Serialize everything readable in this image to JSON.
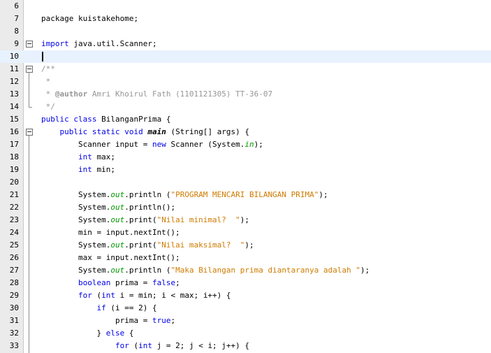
{
  "editor": {
    "lines": [
      {
        "n": "6",
        "tokens": []
      },
      {
        "n": "7",
        "tokens": [
          {
            "t": "package kuistakehome;",
            "c": ""
          }
        ]
      },
      {
        "n": "8",
        "tokens": []
      },
      {
        "n": "9",
        "tokens": [
          {
            "t": "import",
            "c": "kw"
          },
          {
            "t": " java.util.Scanner;",
            "c": ""
          }
        ],
        "fold": "start"
      },
      {
        "n": "10",
        "tokens": [],
        "current": true
      },
      {
        "n": "11",
        "tokens": [
          {
            "t": "/**",
            "c": "cmt"
          }
        ],
        "fold": "start"
      },
      {
        "n": "12",
        "tokens": [
          {
            "t": " *",
            "c": "cmt"
          }
        ],
        "fold": "mid"
      },
      {
        "n": "13",
        "tokens": [
          {
            "t": " * ",
            "c": "cmt"
          },
          {
            "t": "@author",
            "c": "tag"
          },
          {
            "t": " Amri Khoirul Fath (1101121305) TT-36-07",
            "c": "cmt"
          }
        ],
        "fold": "mid"
      },
      {
        "n": "14",
        "tokens": [
          {
            "t": " */",
            "c": "cmt"
          }
        ],
        "fold": "end"
      },
      {
        "n": "15",
        "tokens": [
          {
            "t": "public class",
            "c": "kw"
          },
          {
            "t": " BilanganPrima {",
            "c": ""
          }
        ]
      },
      {
        "n": "16",
        "tokens": [
          {
            "t": "    ",
            "c": ""
          },
          {
            "t": "public static void",
            "c": "kw"
          },
          {
            "t": " ",
            "c": ""
          },
          {
            "t": "main",
            "c": "method-decl"
          },
          {
            "t": " (String[] args) {",
            "c": ""
          }
        ],
        "fold": "start"
      },
      {
        "n": "17",
        "tokens": [
          {
            "t": "        Scanner input = ",
            "c": ""
          },
          {
            "t": "new",
            "c": "kw"
          },
          {
            "t": " Scanner (System.",
            "c": ""
          },
          {
            "t": "in",
            "c": "field"
          },
          {
            "t": ");",
            "c": ""
          }
        ]
      },
      {
        "n": "18",
        "tokens": [
          {
            "t": "        ",
            "c": ""
          },
          {
            "t": "int",
            "c": "kw"
          },
          {
            "t": " max;",
            "c": ""
          }
        ]
      },
      {
        "n": "19",
        "tokens": [
          {
            "t": "        ",
            "c": ""
          },
          {
            "t": "int",
            "c": "kw"
          },
          {
            "t": " min;",
            "c": ""
          }
        ]
      },
      {
        "n": "20",
        "tokens": []
      },
      {
        "n": "21",
        "tokens": [
          {
            "t": "        System.",
            "c": ""
          },
          {
            "t": "out",
            "c": "field"
          },
          {
            "t": ".println (",
            "c": ""
          },
          {
            "t": "\"PROGRAM MENCARI BILANGAN PRIMA\"",
            "c": "str"
          },
          {
            "t": ");",
            "c": ""
          }
        ]
      },
      {
        "n": "22",
        "tokens": [
          {
            "t": "        System.",
            "c": ""
          },
          {
            "t": "out",
            "c": "field"
          },
          {
            "t": ".println();",
            "c": ""
          }
        ]
      },
      {
        "n": "23",
        "tokens": [
          {
            "t": "        System.",
            "c": ""
          },
          {
            "t": "out",
            "c": "field"
          },
          {
            "t": ".print(",
            "c": ""
          },
          {
            "t": "\"Nilai minimal?  \"",
            "c": "str"
          },
          {
            "t": ");",
            "c": ""
          }
        ]
      },
      {
        "n": "24",
        "tokens": [
          {
            "t": "        min = input.nextInt();",
            "c": ""
          }
        ]
      },
      {
        "n": "25",
        "tokens": [
          {
            "t": "        System.",
            "c": ""
          },
          {
            "t": "out",
            "c": "field"
          },
          {
            "t": ".print(",
            "c": ""
          },
          {
            "t": "\"Nilai maksimal?  \"",
            "c": "str"
          },
          {
            "t": ");",
            "c": ""
          }
        ]
      },
      {
        "n": "26",
        "tokens": [
          {
            "t": "        max = input.nextInt();",
            "c": ""
          }
        ]
      },
      {
        "n": "27",
        "tokens": [
          {
            "t": "        System.",
            "c": ""
          },
          {
            "t": "out",
            "c": "field"
          },
          {
            "t": ".println (",
            "c": ""
          },
          {
            "t": "\"Maka Bilangan prima diantaranya adalah \"",
            "c": "str"
          },
          {
            "t": ");",
            "c": ""
          }
        ]
      },
      {
        "n": "28",
        "tokens": [
          {
            "t": "        ",
            "c": ""
          },
          {
            "t": "boolean",
            "c": "kw"
          },
          {
            "t": " prima = ",
            "c": ""
          },
          {
            "t": "false",
            "c": "kw"
          },
          {
            "t": ";",
            "c": ""
          }
        ]
      },
      {
        "n": "29",
        "tokens": [
          {
            "t": "        ",
            "c": ""
          },
          {
            "t": "for",
            "c": "kw"
          },
          {
            "t": " (",
            "c": ""
          },
          {
            "t": "int",
            "c": "kw"
          },
          {
            "t": " i = min; i < max; i++) {",
            "c": ""
          }
        ]
      },
      {
        "n": "30",
        "tokens": [
          {
            "t": "            ",
            "c": ""
          },
          {
            "t": "if",
            "c": "kw"
          },
          {
            "t": " (i == 2) {",
            "c": ""
          }
        ]
      },
      {
        "n": "31",
        "tokens": [
          {
            "t": "                prima = ",
            "c": ""
          },
          {
            "t": "true",
            "c": "kw"
          },
          {
            "t": ";",
            "c": ""
          }
        ]
      },
      {
        "n": "32",
        "tokens": [
          {
            "t": "            } ",
            "c": ""
          },
          {
            "t": "else",
            "c": "kw"
          },
          {
            "t": " {",
            "c": ""
          }
        ]
      },
      {
        "n": "33",
        "tokens": [
          {
            "t": "                ",
            "c": ""
          },
          {
            "t": "for",
            "c": "kw"
          },
          {
            "t": " (",
            "c": ""
          },
          {
            "t": "int",
            "c": "kw"
          },
          {
            "t": " j = 2; j < i; j++) {",
            "c": ""
          }
        ]
      }
    ]
  }
}
